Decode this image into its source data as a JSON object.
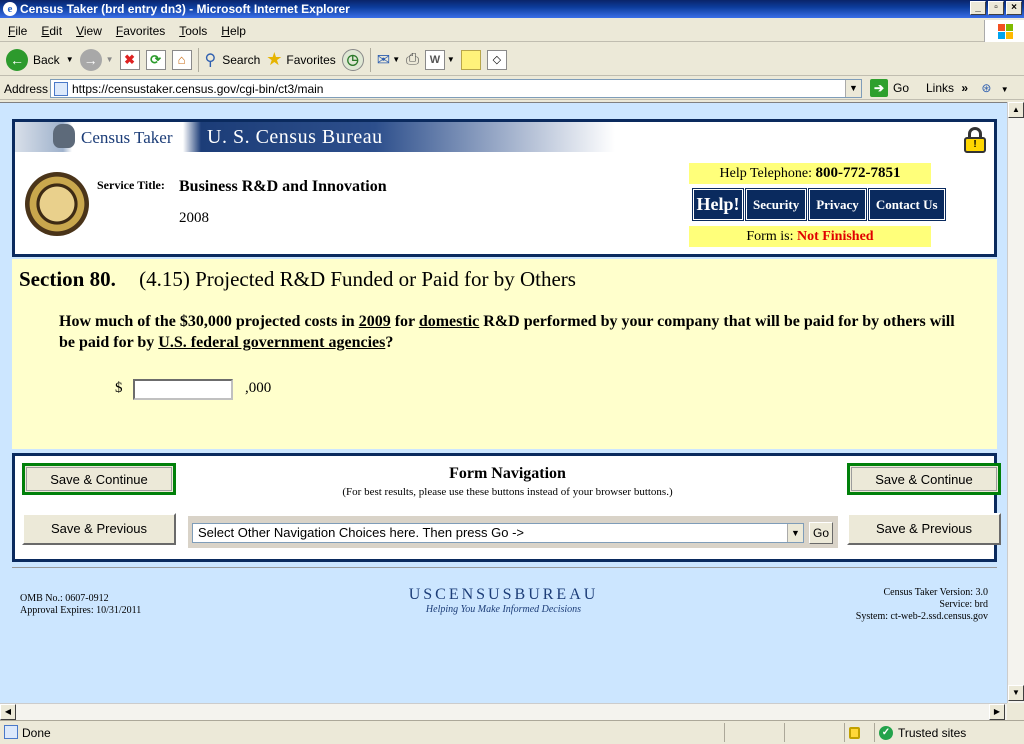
{
  "window": {
    "title": "Census Taker (brd entry dn3) - Microsoft Internet Explorer"
  },
  "menu": [
    "File",
    "Edit",
    "View",
    "Favorites",
    "Tools",
    "Help"
  ],
  "toolbar": {
    "back": "Back",
    "search": "Search",
    "favorites": "Favorites"
  },
  "address": {
    "label": "Address",
    "url": "https://censustaker.census.gov/cgi-bin/ct3/main",
    "go": "Go",
    "links": "Links"
  },
  "header": {
    "app_name": "Census Taker",
    "bureau": "U. S. Census Bureau",
    "service_label": "Service Title:",
    "service_title": "Business R&D and Innovation",
    "year": "2008",
    "help_tel_label": "Help Telephone:",
    "help_tel_number": "800-772-7851",
    "nav_buttons": [
      "Help!",
      "Security",
      "Privacy",
      "Contact Us"
    ],
    "form_status_label": "Form is:",
    "form_status_value": "Not Finished"
  },
  "question": {
    "section": "Section 80.",
    "section_title": "(4.15) Projected R&D Funded or Paid for by Others",
    "text_1": "How much of the $30,000 projected costs in ",
    "u_1": "2009",
    "text_2": " for ",
    "u_2": "domestic",
    "text_3": " R&D performed by your company that will be paid for by others will be paid for by ",
    "u_3": "U.S. federal government agencies",
    "text_4": "?",
    "currency": "$",
    "amount_value": "",
    "suffix": ",000"
  },
  "form_nav": {
    "title": "Form Navigation",
    "subtitle": "(For best results, please use these buttons instead of your browser buttons.)",
    "save_continue": "Save & Continue",
    "save_previous": "Save & Previous",
    "select_text": "Select Other Navigation Choices here. Then press Go ->",
    "go": "Go"
  },
  "footer": {
    "omb": "OMB No.: 0607-0912",
    "approval": "Approval Expires: 10/31/2011",
    "logo_a": "USCENSUS",
    "logo_b": "BUREAU",
    "tagline": "Helping You Make Informed Decisions",
    "version": "Census Taker Version: 3.0",
    "service": "Service: brd",
    "system": "System: ct-web-2.ssd.census.gov"
  },
  "status": {
    "text": "Done",
    "zone": "Trusted sites"
  }
}
